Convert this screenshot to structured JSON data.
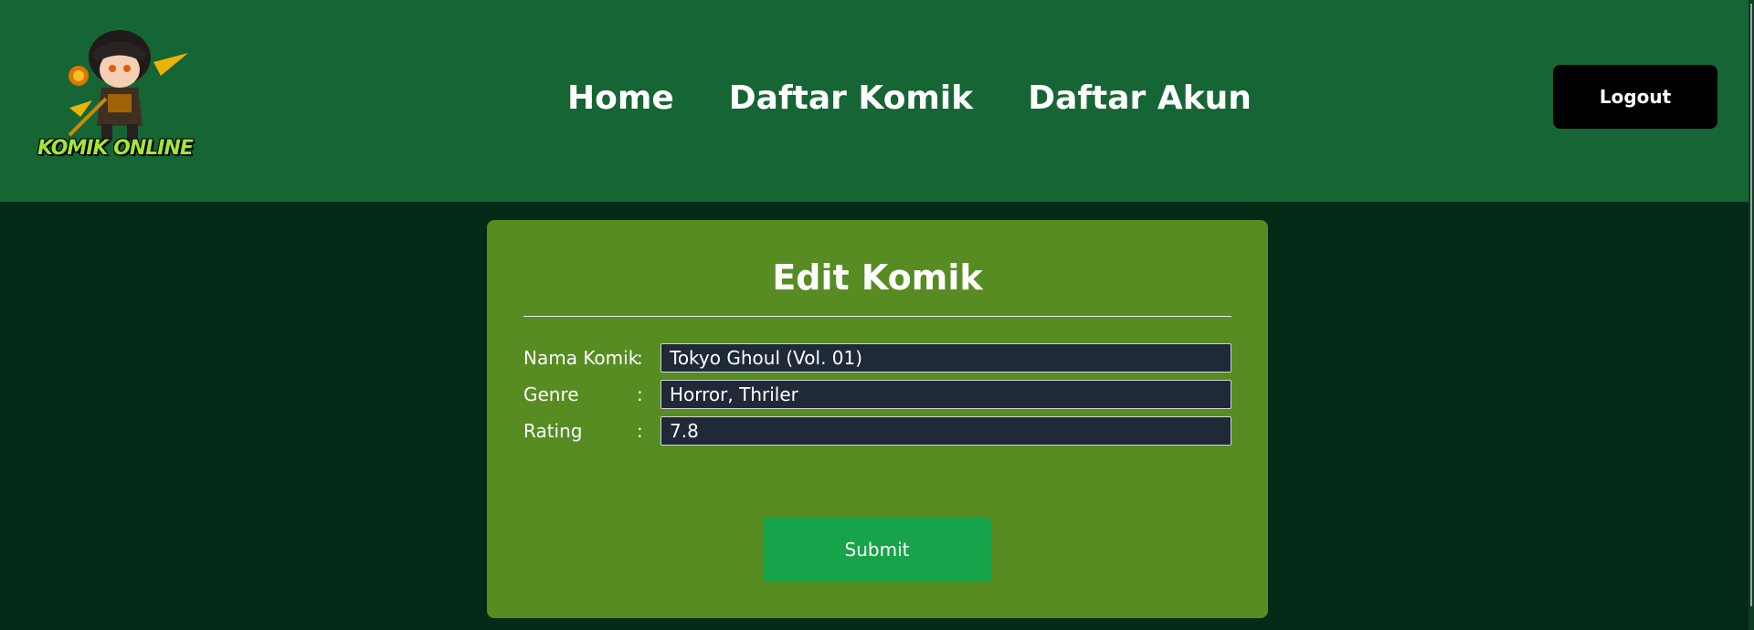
{
  "header": {
    "logo_text": "KOMIK ONLINE",
    "nav": [
      "Home",
      "Daftar Komik",
      "Daftar Akun"
    ],
    "logout_label": "Logout"
  },
  "form": {
    "title": "Edit Komik",
    "fields": [
      {
        "label": "Nama Komik",
        "colon": ":",
        "value": "Tokyo Ghoul (Vol. 01)"
      },
      {
        "label": "Genre",
        "colon": ":",
        "value": "Horror, Thriler"
      },
      {
        "label": "Rating",
        "colon": ":",
        "value": "7.8"
      }
    ],
    "submit_label": "Submit"
  },
  "colors": {
    "header_bg": "#166534",
    "page_bg": "#032a17",
    "card_bg": "#568c22",
    "submit_bg": "#16a34a",
    "input_bg": "#1f2937",
    "logout_bg": "#000000"
  }
}
